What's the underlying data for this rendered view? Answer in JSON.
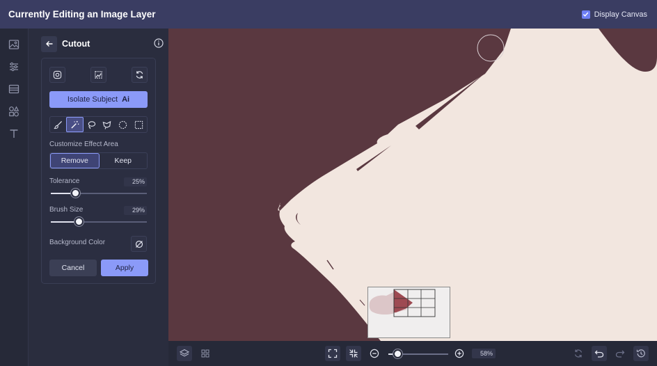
{
  "app": {
    "title": "Currently Editing an Image Layer",
    "display_canvas": {
      "label": "Display Canvas",
      "checked": true
    }
  },
  "sidebar": {
    "items": [
      {
        "name": "image",
        "icon": "image-icon"
      },
      {
        "name": "adjust",
        "icon": "sliders-icon"
      },
      {
        "name": "layout",
        "icon": "layout-icon"
      },
      {
        "name": "elements",
        "icon": "shapes-icon"
      },
      {
        "name": "text",
        "icon": "text-icon"
      }
    ]
  },
  "panel": {
    "title": "Cutout",
    "isolate_label": "Isolate Subject",
    "ai_badge": "Ai",
    "effect_area_label": "Customize Effect Area",
    "remove_label": "Remove",
    "keep_label": "Keep",
    "tolerance_label": "Tolerance",
    "tolerance_value": "25%",
    "tolerance_fraction": 0.25,
    "brush_size_label": "Brush Size",
    "brush_size_value": "29%",
    "brush_size_fraction": 0.29,
    "background_color_label": "Background Color",
    "cancel_label": "Cancel",
    "apply_label": "Apply"
  },
  "toolbar": {
    "zoom_value": "58%",
    "zoom_fraction": 0.15
  },
  "colors": {
    "accent": "#8b9af8",
    "topbar": "#3a3d62",
    "canvas_bg": "#5a3840",
    "subject": "#f2e6df"
  }
}
